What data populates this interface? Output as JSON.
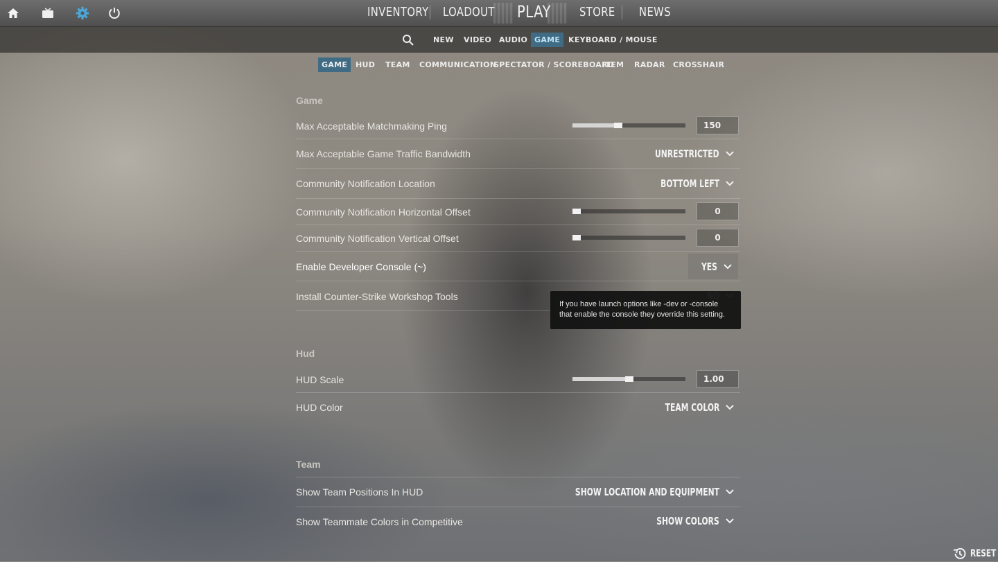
{
  "topbar": {
    "icons": [
      "home-icon",
      "tv-icon",
      "gear-icon",
      "power-icon"
    ],
    "nav": {
      "inventory": "INVENTORY",
      "loadout": "LOADOUT",
      "play": "PLAY",
      "store": "STORE",
      "news": "NEWS"
    }
  },
  "subnav": {
    "search_icon": "search-icon",
    "items": [
      "NEW",
      "VIDEO",
      "AUDIO",
      "GAME",
      "KEYBOARD / MOUSE"
    ],
    "active": "GAME",
    "accent_color": "#3f6b84"
  },
  "tabs": {
    "items": [
      "GAME",
      "HUD",
      "TEAM",
      "COMMUNICATION",
      "SPECTATOR / SCOREBOARD",
      "ITEM",
      "RADAR",
      "CROSSHAIR"
    ],
    "active": "GAME"
  },
  "sections": {
    "game": {
      "heading": "Game",
      "rows": {
        "ping": {
          "label": "Max Acceptable Matchmaking Ping",
          "value": "150",
          "slider_fraction": 0.4
        },
        "bandwidth": {
          "label": "Max Acceptable Game Traffic Bandwidth",
          "value": "UNRESTRICTED"
        },
        "notif_location": {
          "label": "Community Notification Location",
          "value": "BOTTOM LEFT"
        },
        "notif_h_offset": {
          "label": "Community Notification Horizontal Offset",
          "value": "0",
          "slider_fraction": 0.0
        },
        "notif_v_offset": {
          "label": "Community Notification Vertical Offset",
          "value": "0",
          "slider_fraction": 0.0
        },
        "dev_console": {
          "label": "Enable Developer Console (~)",
          "value": "YES"
        },
        "workshop": {
          "label": "Install Counter-Strike Workshop Tools",
          "value": "NO"
        }
      }
    },
    "hud": {
      "heading": "Hud",
      "rows": {
        "scale": {
          "label": "HUD Scale",
          "value": "1.00",
          "slider_fraction": 0.5
        },
        "color": {
          "label": "HUD Color",
          "value": "TEAM COLOR"
        }
      }
    },
    "team": {
      "heading": "Team",
      "rows": {
        "positions": {
          "label": "Show Team Positions In HUD",
          "value": "SHOW LOCATION AND EQUIPMENT"
        },
        "teammate_colors": {
          "label": "Show Teammate Colors in Competitive",
          "value": "SHOW COLORS"
        }
      }
    }
  },
  "tooltip": {
    "line1": "If you have launch options like -dev or -console",
    "line2": "that enable the console they override this setting."
  },
  "footer": {
    "reset_icon": "reset-history-icon",
    "reset_label": "RESET"
  }
}
